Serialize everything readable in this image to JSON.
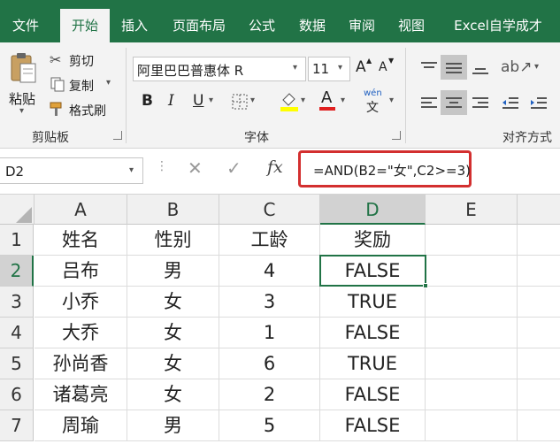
{
  "tabs": [
    {
      "label": "文件",
      "active": false
    },
    {
      "label": "开始",
      "active": true
    },
    {
      "label": "插入",
      "active": false
    },
    {
      "label": "页面布局",
      "active": false
    },
    {
      "label": "公式",
      "active": false
    },
    {
      "label": "数据",
      "active": false
    },
    {
      "label": "审阅",
      "active": false
    },
    {
      "label": "视图",
      "active": false
    },
    {
      "label": "Excel自学成才",
      "active": false
    }
  ],
  "ribbon": {
    "clipboard": {
      "paste": "粘贴",
      "cut": "剪切",
      "copy": "复制",
      "format_painter": "格式刷",
      "group": "剪贴板"
    },
    "font": {
      "name": "阿里巴巴普惠体 R",
      "size": "11",
      "group": "字体",
      "bold": "B",
      "italic": "I",
      "underline": "U",
      "grow": "A",
      "shrink": "A",
      "wen_top": "wén",
      "wen_bottom": "文"
    },
    "alignment": {
      "group": "对齐方式"
    }
  },
  "formula_bar": {
    "name_box": "D2",
    "fx": "fx",
    "formula": "=AND(B2=\"女\",C2>=3)"
  },
  "sheet": {
    "columns": [
      "A",
      "B",
      "C",
      "D",
      "E"
    ],
    "row_numbers": [
      "1",
      "2",
      "3",
      "4",
      "5",
      "6",
      "7"
    ],
    "rows": [
      [
        "姓名",
        "性别",
        "工龄",
        "奖励",
        ""
      ],
      [
        "吕布",
        "男",
        "4",
        "FALSE",
        ""
      ],
      [
        "小乔",
        "女",
        "3",
        "TRUE",
        ""
      ],
      [
        "大乔",
        "女",
        "1",
        "FALSE",
        ""
      ],
      [
        "孙尚香",
        "女",
        "6",
        "TRUE",
        ""
      ],
      [
        "诸葛亮",
        "女",
        "2",
        "FALSE",
        ""
      ],
      [
        "周瑜",
        "男",
        "5",
        "FALSE",
        ""
      ]
    ],
    "selected_cell": "D2"
  },
  "colors": {
    "brand": "#217346",
    "highlight": "#d32f2f"
  }
}
